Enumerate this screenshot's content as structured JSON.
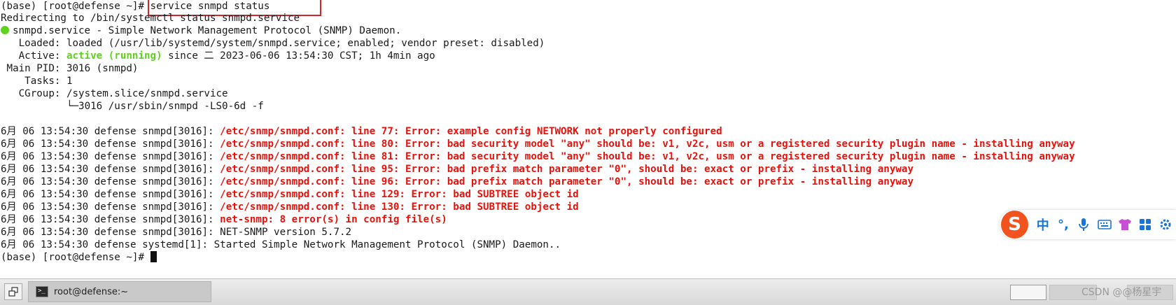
{
  "terminal": {
    "prompt": "(base) [root@defense ~]# ",
    "command": "service snmpd status",
    "redirect": "Redirecting to /bin/systemctl status snmpd.service",
    "service_title": "snmpd.service - Simple Network Management Protocol (SNMP) Daemon.",
    "loaded": "   Loaded: loaded (/usr/lib/systemd/system/snmpd.service; enabled; vendor preset: disabled)",
    "active_prefix": "   Active: ",
    "active_state": "active (running)",
    "active_suffix": " since 二 2023-06-06 13:54:30 CST; 1h 4min ago",
    "main_pid": " Main PID: 3016 (snmpd)",
    "tasks": "    Tasks: 1",
    "cgroup": "   CGroup: /system.slice/snmpd.service",
    "cgroup_child": "           └─3016 /usr/sbin/snmpd -LS0-6d -f",
    "log": [
      {
        "prefix": "6月 06 13:54:30 defense snmpd[3016]: ",
        "message": "/etc/snmp/snmpd.conf: line 77: Error: example config NETWORK not properly configured",
        "error": true
      },
      {
        "prefix": "6月 06 13:54:30 defense snmpd[3016]: ",
        "message": "/etc/snmp/snmpd.conf: line 80: Error: bad security model \"any\" should be: v1, v2c, usm or a registered security plugin name - installing anyway",
        "error": true
      },
      {
        "prefix": "6月 06 13:54:30 defense snmpd[3016]: ",
        "message": "/etc/snmp/snmpd.conf: line 81: Error: bad security model \"any\" should be: v1, v2c, usm or a registered security plugin name - installing anyway",
        "error": true
      },
      {
        "prefix": "6月 06 13:54:30 defense snmpd[3016]: ",
        "message": "/etc/snmp/snmpd.conf: line 95: Error: bad prefix match parameter \"0\", should be: exact or prefix - installing anyway",
        "error": true
      },
      {
        "prefix": "6月 06 13:54:30 defense snmpd[3016]: ",
        "message": "/etc/snmp/snmpd.conf: line 96: Error: bad prefix match parameter \"0\", should be: exact or prefix - installing anyway",
        "error": true
      },
      {
        "prefix": "6月 06 13:54:30 defense snmpd[3016]: ",
        "message": "/etc/snmp/snmpd.conf: line 129: Error: bad SUBTREE object id",
        "error": true
      },
      {
        "prefix": "6月 06 13:54:30 defense snmpd[3016]: ",
        "message": "/etc/snmp/snmpd.conf: line 130: Error: bad SUBTREE object id",
        "error": true
      },
      {
        "prefix": "6月 06 13:54:30 defense snmpd[3016]: ",
        "message": "net-snmp: 8 error(s) in config file(s)",
        "error": true
      },
      {
        "prefix": "6月 06 13:54:30 defense snmpd[3016]: ",
        "message": "NET-SNMP version 5.7.2",
        "error": false
      },
      {
        "prefix": "6月 06 13:54:30 defense systemd[1]: ",
        "message": "Started Simple Network Management Protocol (SNMP) Daemon..",
        "error": false
      }
    ],
    "final_prompt": "(base) [root@defense ~]# "
  },
  "colors": {
    "error_red": "#e8120c",
    "active_green": "#5fd21e",
    "highlight_box": "#d4242c",
    "ime_brand": "#f2531e"
  },
  "ime_toolbar": {
    "logo": "S",
    "mode_label": "中",
    "punct_label": "°,",
    "icons": [
      "microphone-icon",
      "keyboard-icon",
      "skin-shirt-icon",
      "apps-grid-icon",
      "settings-icon"
    ]
  },
  "taskbar": {
    "window_label": "root@defense:~",
    "watermark": "CSDN @@杨星宇"
  }
}
